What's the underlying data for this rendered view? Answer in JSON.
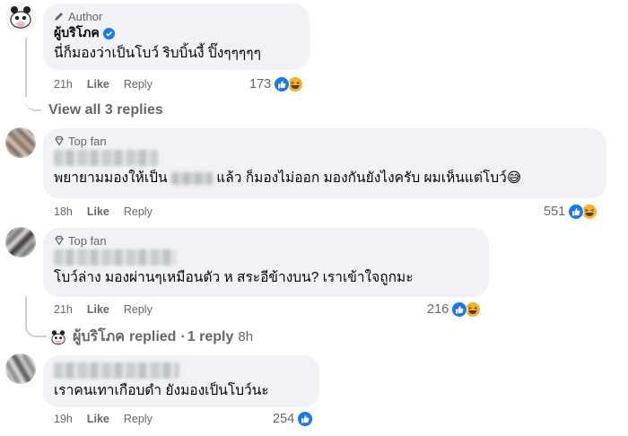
{
  "comments": [
    {
      "badge": "Author",
      "name": "ผู้บริโภค",
      "verified": true,
      "text": "นี่ก็มองว่าเป็นโบว์ ริบบิ้นงี้ ปิ๊งๆๆๆๆๆ",
      "time": "21h",
      "like": "Like",
      "reply": "Reply",
      "reactions": "173"
    },
    {
      "badge": "Top fan",
      "text_before": "พยายามมองให้เป็น",
      "text_after": "แล้ว ก็มองไม่ออก มองกันยังไงครับ ผมเห็นแต่โบว์",
      "text_emoji": "😅",
      "time": "18h",
      "like": "Like",
      "reply": "Reply",
      "reactions": "551"
    },
    {
      "badge": "Top fan",
      "text": "โบว์ล่าง มองผ่านๆเหมือนตัว ห สระอีข้างบน? เราเข้าใจถูกมะ",
      "time": "21h",
      "like": "Like",
      "reply": "Reply",
      "reactions": "216"
    },
    {
      "text": "เราคนเทาเกือบดำ ยังมองเป็นโบว์นะ",
      "time": "19h",
      "like": "Like",
      "reply": "Reply",
      "reactions": "254"
    }
  ],
  "view_replies": "View all 3 replies",
  "reply_summary": {
    "name": "ผู้บริโภค",
    "replied": "replied",
    "sep": "·",
    "count": "1 reply",
    "time": "8h"
  },
  "colors": {
    "like_blue": "#1877f2",
    "bubble": "#f0f2f5",
    "secondary_text": "#65676b",
    "haha_yellow": "#f7b125"
  }
}
